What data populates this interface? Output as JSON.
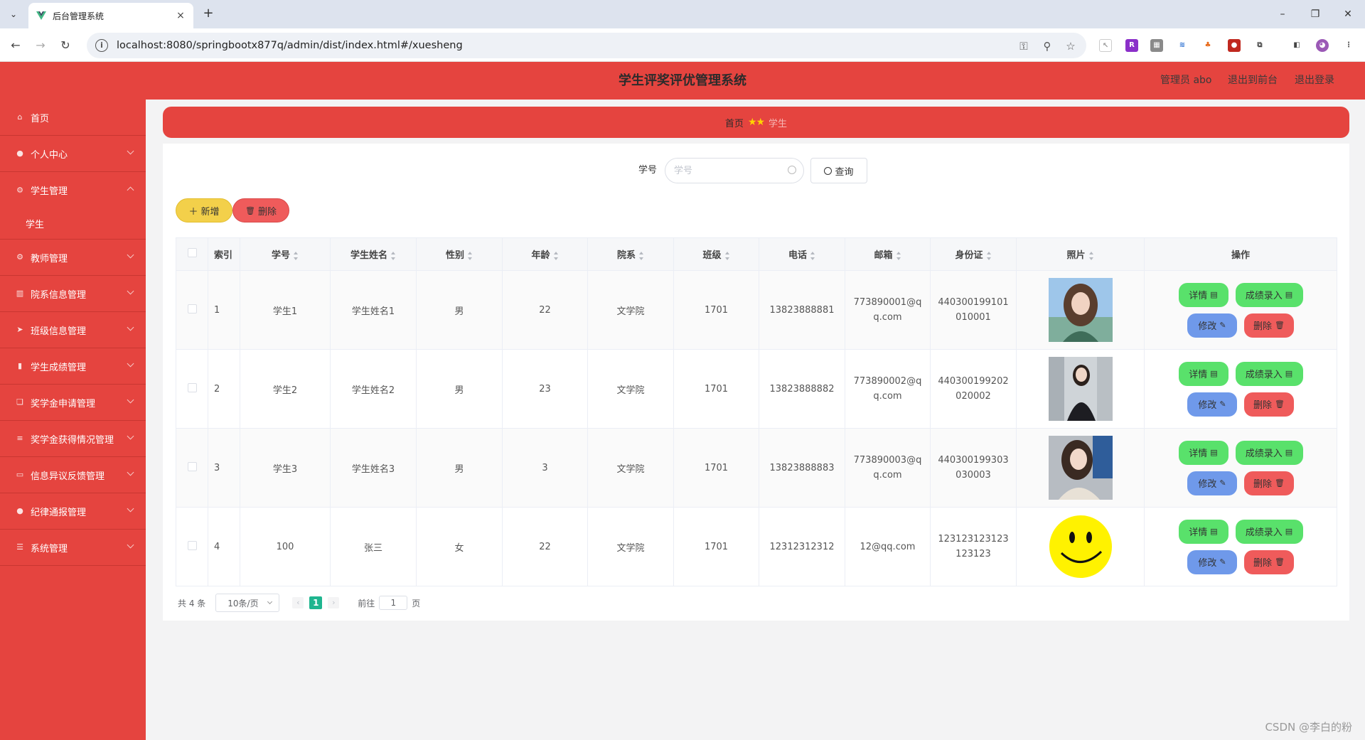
{
  "browser": {
    "tab_title": "后台管理系统",
    "tab_close": "×",
    "new_tab": "+",
    "url": "localhost:8080/springbootx877q/admin/dist/index.html#/xuesheng"
  },
  "header": {
    "title": "学生评奖评优管理系统",
    "admin_label": "管理员 abo",
    "to_frontend": "退出到前台",
    "logout": "退出登录"
  },
  "sidebar": {
    "items": [
      {
        "label": "首页",
        "icon": "home-icon"
      },
      {
        "label": "个人中心",
        "icon": "user-icon"
      },
      {
        "label": "学生管理",
        "icon": "gear-icon"
      },
      {
        "label": "教师管理",
        "icon": "gear-icon"
      },
      {
        "label": "院系信息管理",
        "icon": "building-icon"
      },
      {
        "label": "班级信息管理",
        "icon": "send-icon"
      },
      {
        "label": "学生成绩管理",
        "icon": "chart-icon"
      },
      {
        "label": "奖学金申请管理",
        "icon": "copy-icon"
      },
      {
        "label": "奖学金获得情况管理",
        "icon": "list-icon"
      },
      {
        "label": "信息异议反馈管理",
        "icon": "message-icon"
      },
      {
        "label": "纪律通报管理",
        "icon": "user-icon"
      },
      {
        "label": "系统管理",
        "icon": "sliders-icon"
      }
    ],
    "subitem": "学生"
  },
  "breadcrumb": {
    "home": "首页",
    "separator": "★★",
    "current": "学生"
  },
  "search": {
    "label": "学号",
    "placeholder": "学号",
    "query_button": "查询"
  },
  "actions": {
    "add": "新增",
    "delete": "删除"
  },
  "table": {
    "columns": [
      "索引",
      "学号",
      "学生姓名",
      "性别",
      "年龄",
      "院系",
      "班级",
      "电话",
      "邮箱",
      "身份证",
      "照片",
      "操作"
    ],
    "rows": [
      {
        "index": "1",
        "id": "学生1",
        "name": "学生姓名1",
        "gender": "男",
        "age": "22",
        "dept": "文学院",
        "class": "1701",
        "phone": "13823888881",
        "email": "773890001@qq.com",
        "idcard": "440300199101010001"
      },
      {
        "index": "2",
        "id": "学生2",
        "name": "学生姓名2",
        "gender": "男",
        "age": "23",
        "dept": "文学院",
        "class": "1701",
        "phone": "13823888882",
        "email": "773890002@qq.com",
        "idcard": "440300199202020002"
      },
      {
        "index": "3",
        "id": "学生3",
        "name": "学生姓名3",
        "gender": "男",
        "age": "3",
        "dept": "文学院",
        "class": "1701",
        "phone": "13823888883",
        "email": "773890003@qq.com",
        "idcard": "440300199303030003"
      },
      {
        "index": "4",
        "id": "100",
        "name": "张三",
        "gender": "女",
        "age": "22",
        "dept": "文学院",
        "class": "1701",
        "phone": "12312312312",
        "email": "12@qq.com",
        "idcard": "123123123123123123"
      }
    ],
    "ops": {
      "detail": "详情",
      "score": "成绩录入",
      "edit": "修改",
      "delete": "删除"
    }
  },
  "pagination": {
    "total": "共 4 条",
    "page_size": "10条/页",
    "current_page": "1",
    "goto_label": "前往",
    "goto_value": "1",
    "goto_suffix": "页"
  },
  "watermark": "CSDN @李白的粉",
  "colors": {
    "primary": "#e5443f",
    "success": "#59e16b",
    "edit": "#6f99ea",
    "danger": "#ef5b5b",
    "add": "#f3d04a",
    "page_active": "#1fb58f"
  }
}
